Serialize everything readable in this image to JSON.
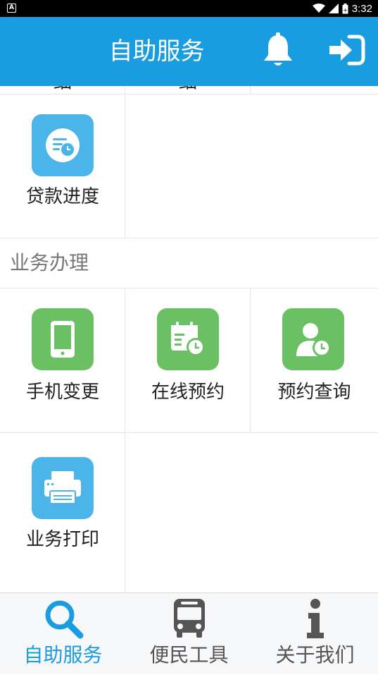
{
  "status_bar": {
    "time": "3:32"
  },
  "app_bar": {
    "title": "自助服务"
  },
  "partial_row": {
    "items": [
      "细",
      "细"
    ]
  },
  "loan_section": {
    "items": [
      {
        "label": "贷款进度",
        "icon": "document-clock-icon",
        "color": "#4bb4e9"
      }
    ]
  },
  "business_section": {
    "title": "业务办理",
    "items": [
      {
        "label": "手机变更",
        "icon": "phone-icon",
        "color": "#6cc064"
      },
      {
        "label": "在线预约",
        "icon": "calendar-clock-icon",
        "color": "#6cc064"
      },
      {
        "label": "预约查询",
        "icon": "person-clock-icon",
        "color": "#6cc064"
      },
      {
        "label": "业务打印",
        "icon": "printer-icon",
        "color": "#4bb4e9"
      }
    ]
  },
  "tab_bar": {
    "tabs": [
      {
        "label": "自助服务",
        "icon": "search-icon",
        "active": true
      },
      {
        "label": "便民工具",
        "icon": "bus-icon",
        "active": false
      },
      {
        "label": "关于我们",
        "icon": "info-icon",
        "active": false
      }
    ]
  },
  "colors": {
    "primary": "#1a9de0",
    "icon_blue": "#4bb4e9",
    "icon_green": "#6cc064",
    "tab_inactive": "#555555"
  }
}
